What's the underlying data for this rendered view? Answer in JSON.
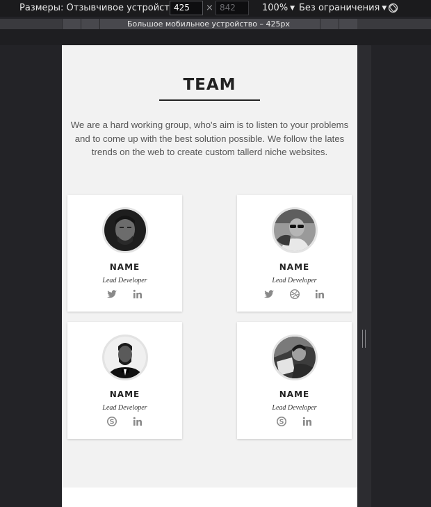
{
  "toolbar": {
    "dimensions_label": "Размеры: Отзывчивое устройство",
    "width_value": "425",
    "height_value": "842",
    "times": "×",
    "zoom": "100%",
    "throttle": "Без ограничения",
    "breakpoint_label": "Большое мобильное устройство – 425px"
  },
  "page": {
    "title": "TEAM",
    "intro": "We are a hard working group, who's aim is to listen to your problems and to come up with the best solution possible. We follow the lates trends on the web to create custom tallerd niche websites."
  },
  "cards": [
    {
      "name": "NAME",
      "role": "Lead Developer",
      "socials": [
        "twitter-icon",
        "linkedin-icon"
      ]
    },
    {
      "name": "NAME",
      "role": "Lead Developer",
      "socials": [
        "twitter-icon",
        "dribbble-icon",
        "linkedin-icon"
      ]
    },
    {
      "name": "NAME",
      "role": "Lead Developer",
      "socials": [
        "skype-icon",
        "linkedin-icon"
      ]
    },
    {
      "name": "NAME",
      "role": "Lead Developer",
      "socials": [
        "skype-icon",
        "linkedin-icon"
      ]
    }
  ],
  "colors": {
    "toolbar_bg": "#1b1b1d",
    "page_bg": "#f2f2f2",
    "card_bg": "#ffffff",
    "social_icon": "#8a8a8a",
    "title_text": "#222222"
  }
}
